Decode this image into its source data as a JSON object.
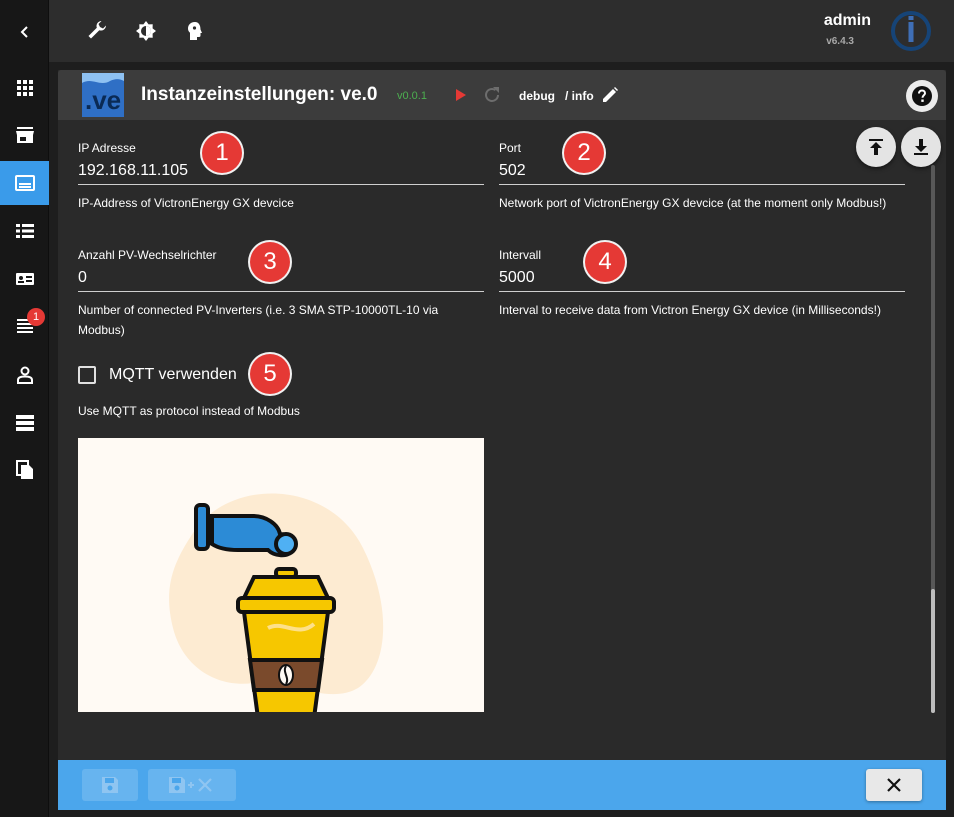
{
  "topbar": {
    "user_name": "admin",
    "version": "v6.4.3"
  },
  "sidebar": {
    "items": [
      {
        "name": "collapse-icon"
      },
      {
        "name": "overview-grid-icon"
      },
      {
        "name": "store-icon"
      },
      {
        "name": "instances-icon",
        "active": true
      },
      {
        "name": "objects-list-icon"
      },
      {
        "name": "enums-icon"
      },
      {
        "name": "logs-icon",
        "badge": "1"
      },
      {
        "name": "users-icon"
      },
      {
        "name": "hosts-icon"
      },
      {
        "name": "files-icon"
      }
    ]
  },
  "dialog": {
    "title": "Instanzeinstellungen: ve.0",
    "version": "v0.0.1",
    "loglevel": "debug",
    "loglevel_sep": "/ info",
    "adapter_logo_text": ".ve"
  },
  "form": {
    "ip": {
      "label": "IP Adresse",
      "value": "192.168.11.105",
      "help": "IP-Address of VictronEnergy GX devcice"
    },
    "port": {
      "label": "Port",
      "value": "502",
      "help": "Network port of VictronEnergy GX devcice (at the moment only Modbus!)"
    },
    "pv": {
      "label": "Anzahl PV-Wechselrichter",
      "value": "0",
      "help": "Number of connected PV-Inverters (i.e. 3 SMA STP-10000TL-10 via Modbus)"
    },
    "interval": {
      "label": "Intervall",
      "value": "5000",
      "help": "Interval to receive data from Victron Energy GX device (in Milliseconds!)"
    },
    "mqtt": {
      "label": "MQTT verwenden",
      "checked": false,
      "help": "Use MQTT as protocol instead of Modbus"
    }
  },
  "markers": [
    "1",
    "2",
    "3",
    "4",
    "5"
  ],
  "colors": {
    "accent": "#4ba6ec",
    "marker": "#e53935",
    "version_green": "#4caf50",
    "play_red": "#e53935"
  }
}
